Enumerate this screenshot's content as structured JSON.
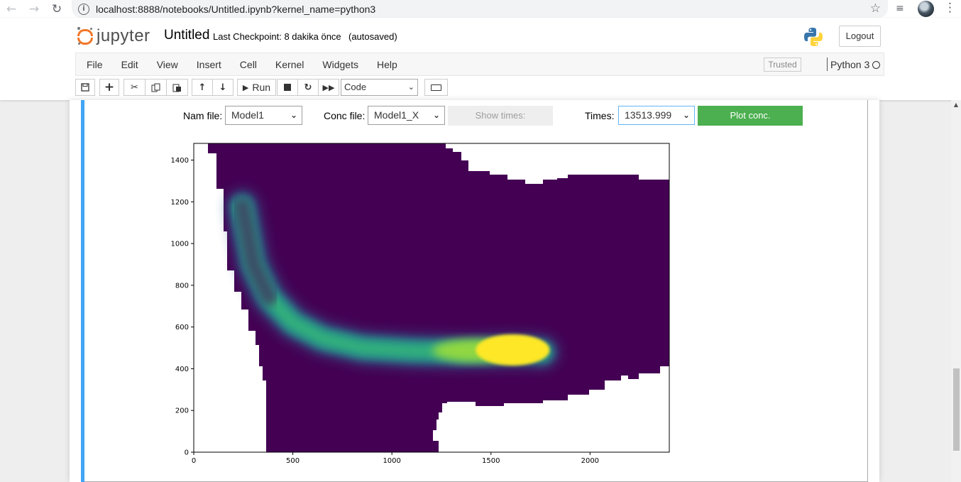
{
  "browser": {
    "url": "localhost:8888/notebooks/Untitled.ipynb?kernel_name=python3",
    "icons": [
      "back-arrow-icon",
      "forward-arrow-icon",
      "reload-icon",
      "info-icon",
      "star-icon",
      "extension-icon",
      "profile-avatar",
      "more-menu-icon"
    ]
  },
  "header": {
    "logo_text": "jupyter",
    "notebook_title": "Untitled",
    "checkpoint": "Last Checkpoint: 8 dakika önce",
    "autosave": "(autosaved)",
    "logout_label": "Logout"
  },
  "menubar": {
    "items": [
      "File",
      "Edit",
      "View",
      "Insert",
      "Cell",
      "Kernel",
      "Widgets",
      "Help"
    ],
    "trusted": "Trusted",
    "kernel": "Python 3"
  },
  "toolbar": {
    "run_label": "Run",
    "cell_type": "Code",
    "icons": [
      "save-icon",
      "plus-icon",
      "cut-icon",
      "copy-icon",
      "paste-icon",
      "arrow-up-icon",
      "arrow-down-icon",
      "run-icon",
      "stop-icon",
      "restart-icon",
      "fast-forward-icon",
      "keyboard-icon"
    ]
  },
  "widgets": {
    "nam_label": "Nam file:",
    "nam_value": "Model1",
    "conc_label": "Conc file:",
    "conc_value": "Model1_X",
    "show_times_label": "Show times:",
    "times_label": "Times:",
    "times_value": "13513.999",
    "plot_label": "Plot conc.",
    "plot_color": "#4caf50"
  },
  "chart_data": {
    "type": "heatmap",
    "colormap": "viridis",
    "xlim": [
      0,
      2400
    ],
    "ylim": [
      0,
      1480
    ],
    "x_ticks": [
      "0",
      "500",
      "1000",
      "1500",
      "2000"
    ],
    "y_ticks": [
      "0",
      "200",
      "400",
      "600",
      "800",
      "1000",
      "1200",
      "1400"
    ],
    "domain_color": "#440154",
    "plume_colors": [
      "#31688e",
      "#21918c",
      "#35b779",
      "#90d743",
      "#fde725"
    ],
    "no_data_color": "#ffffff",
    "plume_path": [
      [
        245,
        1180
      ],
      [
        300,
        900
      ],
      [
        380,
        740
      ],
      [
        500,
        620
      ],
      [
        650,
        545
      ],
      [
        850,
        500
      ],
      [
        1100,
        485
      ],
      [
        1350,
        480
      ],
      [
        1580,
        485
      ],
      [
        1700,
        485
      ],
      [
        1760,
        480
      ]
    ]
  }
}
